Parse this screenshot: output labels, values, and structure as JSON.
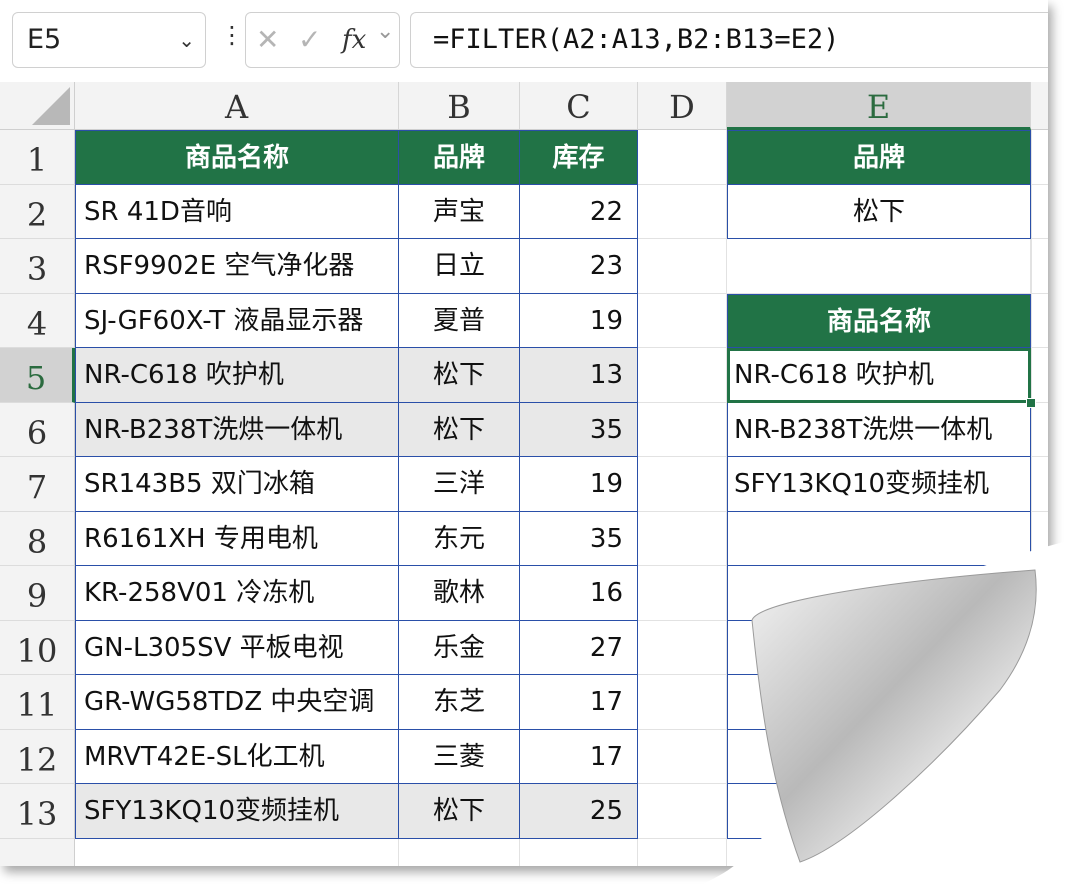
{
  "formula_bar": {
    "name_box": "E5",
    "formula": "=FILTER(A2:A13,B2:B13=E2)",
    "cancel_glyph": "✕",
    "enter_glyph": "✓",
    "fx_label": "fx"
  },
  "columns": [
    "A",
    "B",
    "C",
    "D",
    "E"
  ],
  "rows": [
    "1",
    "2",
    "3",
    "4",
    "5",
    "6",
    "7",
    "8",
    "9",
    "10",
    "11",
    "12",
    "13"
  ],
  "table": {
    "headers": [
      "商品名称",
      "品牌",
      "库存"
    ],
    "rows": [
      {
        "name": "SR 41D音响",
        "brand": "声宝",
        "stock": "22"
      },
      {
        "name": "RSF9902E 空气净化器",
        "brand": "日立",
        "stock": "23"
      },
      {
        "name": "SJ-GF60X-T 液晶显示器",
        "brand": "夏普",
        "stock": "19"
      },
      {
        "name": "NR-C618 吹护机",
        "brand": "松下",
        "stock": "13"
      },
      {
        "name": "NR-B238T洗烘一体机",
        "brand": "松下",
        "stock": "35"
      },
      {
        "name": "SR143B5 双门冰箱",
        "brand": "三洋",
        "stock": "19"
      },
      {
        "name": "R6161XH 专用电机",
        "brand": "东元",
        "stock": "35"
      },
      {
        "name": "KR-258V01 冷冻机",
        "brand": "歌林",
        "stock": "16"
      },
      {
        "name": "GN-L305SV 平板电视",
        "brand": "乐金",
        "stock": "27"
      },
      {
        "name": "GR-WG58TDZ 中央空调",
        "brand": "东芝",
        "stock": "17"
      },
      {
        "name": "MRVT42E-SL化工机",
        "brand": "三菱",
        "stock": "17"
      },
      {
        "name": "SFY13KQ10变频挂机",
        "brand": "松下",
        "stock": "25"
      }
    ]
  },
  "criteria": {
    "header": "品牌",
    "value": "松下"
  },
  "result": {
    "header": "商品名称",
    "values": [
      "NR-C618 吹护机",
      "NR-B238T洗烘一体机",
      "SFY13KQ10变频挂机"
    ]
  },
  "colors": {
    "header_fill": "#217346",
    "table_border": "#2a4fa8",
    "highlight_row": "#e8e8e8"
  }
}
